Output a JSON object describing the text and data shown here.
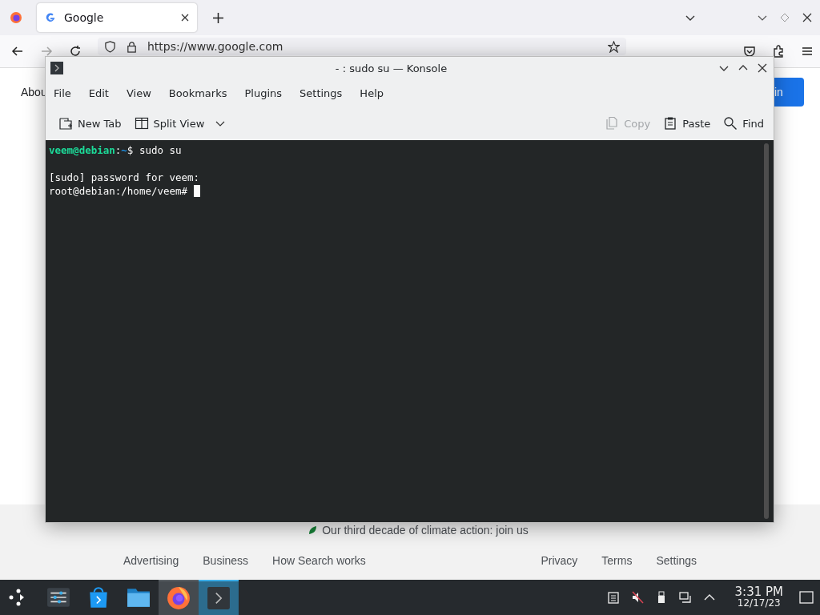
{
  "browser": {
    "tabs": [
      {
        "title": "Google",
        "selected": true
      }
    ],
    "url": "https://www.google.com",
    "page": {
      "nav_left": "Abou",
      "sign_in": "in",
      "climate": "Our third decade of climate action: join us",
      "footer_left": [
        "Advertising",
        "Business",
        "How Search works"
      ],
      "footer_right": [
        "Privacy",
        "Terms",
        "Settings"
      ]
    }
  },
  "konsole": {
    "title": "- : sudo su — Konsole",
    "menu": [
      "File",
      "Edit",
      "View",
      "Bookmarks",
      "Plugins",
      "Settings",
      "Help"
    ],
    "toolbar": [
      {
        "kind": "new-tab",
        "label": "New Tab",
        "disabled": false
      },
      {
        "kind": "split-view",
        "label": "Split View",
        "disabled": false
      },
      {
        "kind": "copy",
        "label": "Copy",
        "disabled": true
      },
      {
        "kind": "paste",
        "label": "Paste",
        "disabled": false
      },
      {
        "kind": "find",
        "label": "Find",
        "disabled": false
      }
    ],
    "prompt": {
      "user_host": "veem@debian",
      "separator": ":",
      "path": "~",
      "command": "$ sudo su"
    },
    "lines": [
      "[sudo] password for veem:",
      "root@debian:/home/veem# "
    ]
  },
  "taskbar": {
    "apps": [
      {
        "kind": "settings",
        "running": false,
        "active": false
      },
      {
        "kind": "store",
        "running": false,
        "active": false
      },
      {
        "kind": "files",
        "running": false,
        "active": false
      },
      {
        "kind": "firefox",
        "running": true,
        "active": false
      },
      {
        "kind": "terminal",
        "running": true,
        "active": true
      }
    ],
    "time": "3:31 PM",
    "date": "12/17/23"
  }
}
